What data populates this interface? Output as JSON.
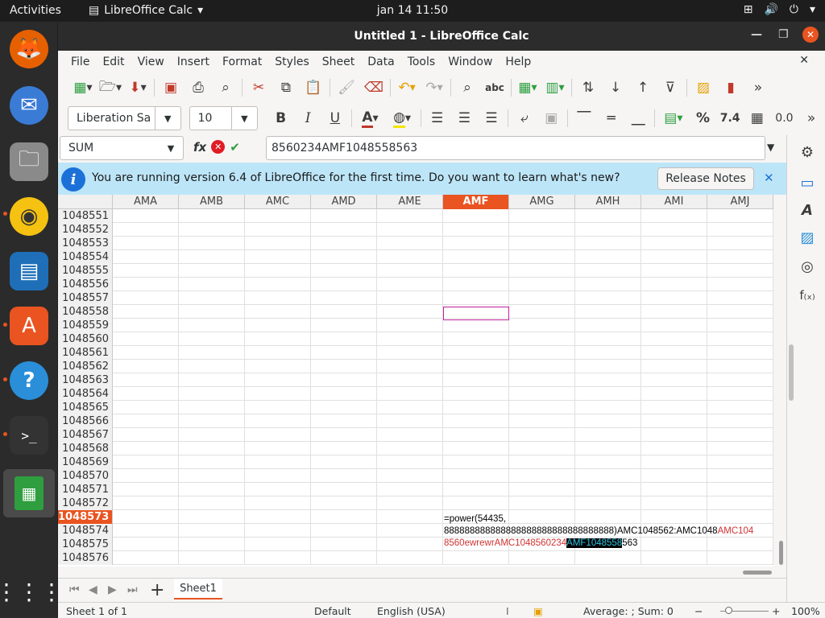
{
  "topbar": {
    "activities": "Activities",
    "app_name": "LibreOffice Calc",
    "clock": "jan 14  11:50"
  },
  "window": {
    "title": "Untitled 1 - LibreOffice Calc"
  },
  "menu": [
    "File",
    "Edit",
    "View",
    "Insert",
    "Format",
    "Styles",
    "Sheet",
    "Data",
    "Tools",
    "Window",
    "Help"
  ],
  "format_toolbar": {
    "font_name": "Liberation Sa",
    "font_size": "10",
    "percent": "%",
    "number": "7.4",
    "decimal": "0.0"
  },
  "formula_bar": {
    "name_box": "SUM",
    "fx": "fx",
    "content": "8560234AMF1048558563"
  },
  "infobar": {
    "message": "You are running version 6.4 of LibreOffice for the first time. Do you want to learn what's new?",
    "button": "Release Notes"
  },
  "columns": [
    "AMA",
    "AMB",
    "AMC",
    "AMD",
    "AME",
    "AMF",
    "AMG",
    "AMH",
    "AMI",
    "AMJ"
  ],
  "selected_column": "AMF",
  "rows": [
    "1048551",
    "1048552",
    "1048553",
    "1048554",
    "1048555",
    "1048556",
    "1048557",
    "1048558",
    "1048559",
    "1048560",
    "1048561",
    "1048562",
    "1048563",
    "1048564",
    "1048565",
    "1048566",
    "1048567",
    "1048568",
    "1048569",
    "1048570",
    "1048571",
    "1048572",
    "1048573",
    "1048574",
    "1048575",
    "1048576"
  ],
  "selected_row": "1048573",
  "cell_edit": {
    "line1": "=power(54435,",
    "line2a": "888888888888888888888888888888888)AMC1048562:AMC1048",
    "line2b": "AMC104",
    "line3a": "8560ewrewrAMC1048560234",
    "line3b": "AMF1048558",
    "line3c": "563"
  },
  "sheet_tab": "Sheet1",
  "status": {
    "sheet": "Sheet 1 of 1",
    "style": "Default",
    "language": "English (USA)",
    "sum": "Average: ; Sum: 0",
    "zoom": "100%"
  },
  "colors": {
    "accent": "#e95420",
    "selection_border": "#c3209e",
    "infobar_bg": "#bde5f8"
  }
}
